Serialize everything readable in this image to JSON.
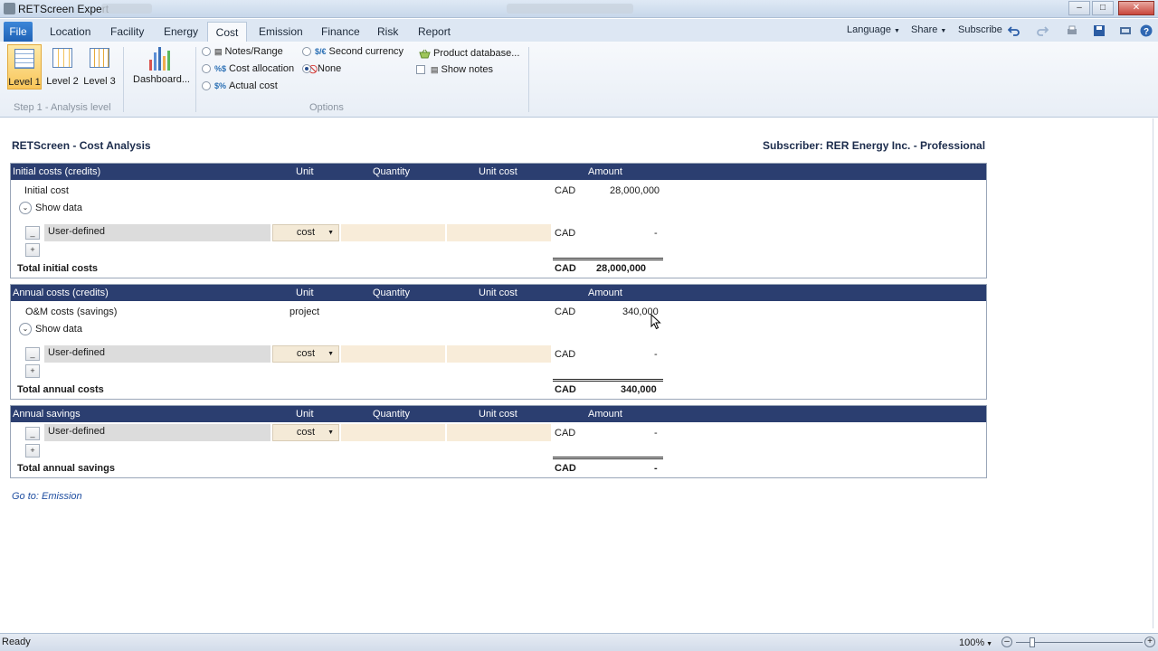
{
  "window": {
    "title": "RETScreen Expert"
  },
  "tabs": [
    "File",
    "Location",
    "Facility",
    "Energy",
    "Cost",
    "Emission",
    "Finance",
    "Risk",
    "Report"
  ],
  "active_tab": "Cost",
  "toolbar_right": {
    "language": "Language",
    "share": "Share",
    "subscribe": "Subscribe"
  },
  "ribbon": {
    "levels": [
      "Level 1",
      "Level 2",
      "Level 3"
    ],
    "selected_level": "Level 1",
    "dashboard": "Dashboard...",
    "step_label": "Step 1 - Analysis level",
    "options_label": "Options",
    "options": {
      "notes_range": "Notes/Range",
      "cost_allocation": "Cost allocation",
      "actual_cost": "Actual cost",
      "second_currency": "Second currency",
      "none": "None",
      "product_database": "Product database...",
      "show_notes": "Show notes",
      "glyph_allocation": "%$",
      "glyph_actual": "$%",
      "glyph_currency": "$/€"
    }
  },
  "report": {
    "title": "RETScreen - Cost Analysis",
    "subscriber": "Subscriber: RER Energy Inc. - Professional",
    "columns": {
      "unit": "Unit",
      "quantity": "Quantity",
      "unit_cost": "Unit cost",
      "amount": "Amount"
    },
    "show_data": "Show data",
    "user_defined": "User-defined",
    "unit_option": "cost",
    "currency": "CAD",
    "dash": "-",
    "initial": {
      "header": "Initial costs (credits)",
      "row_label": "Initial cost",
      "row_amount": "28,000,000",
      "total_label": "Total initial costs",
      "total_amount": "28,000,000"
    },
    "annual": {
      "header": "Annual costs (credits)",
      "row_label": "O&M costs (savings)",
      "row_unit": "project",
      "row_amount": "340,000",
      "total_label": "Total annual costs",
      "total_amount": "340,000"
    },
    "savings": {
      "header": "Annual savings",
      "total_label": "Total annual savings",
      "total_amount": "-"
    },
    "goto": "Go to: Emission"
  },
  "status": {
    "text": "Ready",
    "zoom": "100%"
  }
}
